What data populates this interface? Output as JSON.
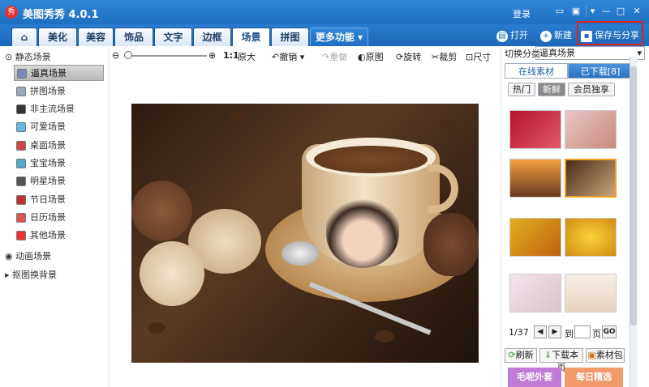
{
  "window": {
    "title": "美图秀秀 4.0.1",
    "logo_text": "秀",
    "login": "登录"
  },
  "nav": {
    "tabs": [
      "美化",
      "美容",
      "饰品",
      "文字",
      "边框",
      "场景",
      "拼图",
      "更多功能"
    ],
    "active": "场景",
    "open": "打开",
    "new": "新建",
    "save_share": "保存与分享"
  },
  "left": {
    "group1": "静态场景",
    "items": [
      "逼真场景",
      "拼图场景",
      "非主流场景",
      "可爱场景",
      "桌面场景",
      "宝宝场景",
      "明星场景",
      "节日场景",
      "日历场景",
      "其他场景"
    ],
    "selected": "逼真场景",
    "group2": "动画场景",
    "group3": "抠图换背景"
  },
  "toolbar": {
    "zoom_label": "1:1",
    "original_size": "原大",
    "undo": "撤销",
    "redo": "重做",
    "original": "原图",
    "rotate": "旋转",
    "crop": "裁剪",
    "size": "尺寸"
  },
  "right": {
    "category_label": "切换分类",
    "category_value": "逼真场景",
    "tab_online": "在线素材",
    "tab_downloaded": "已下载[8]",
    "filters": [
      "热门",
      "新鲜",
      "会员独享"
    ],
    "filter_active": "新鲜",
    "pager": {
      "page": "1/37",
      "goto": "到",
      "page_unit": "页",
      "go": "GO"
    },
    "actions": [
      "刷新",
      "下载本页",
      "素材包"
    ],
    "banners": [
      "毛呢外套",
      "每日精选"
    ]
  },
  "colors": {
    "accent": "#1f6fc2",
    "highlight": "#e0221f"
  }
}
